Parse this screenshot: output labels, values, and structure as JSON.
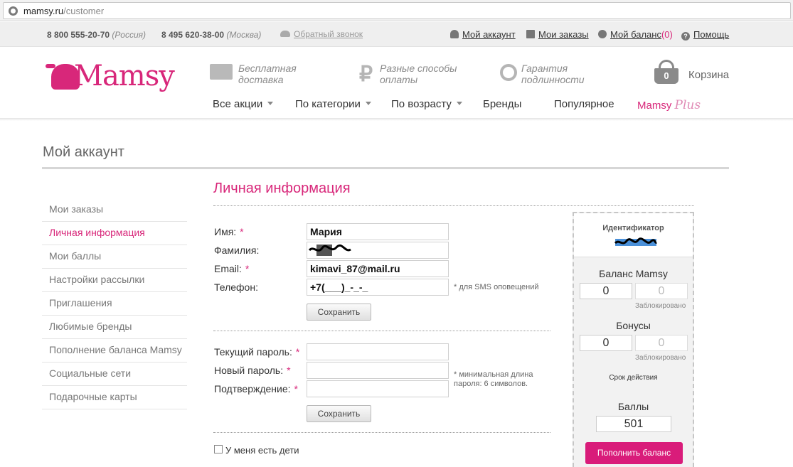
{
  "browser": {
    "url_host": "mamsy.ru",
    "url_path": "/customer"
  },
  "topbar": {
    "phone1": "8 800 555-20-70",
    "phone1_region": "(Россия)",
    "phone2": "8 495 620-38-00",
    "phone2_region": "(Москва)",
    "callback": "Обратный звонок",
    "account": "Мой аккаунт",
    "orders": "Мои заказы",
    "balance": "Мой баланс",
    "balance_count": "(0)",
    "help": "Помощь"
  },
  "header": {
    "logo": "Mamsy",
    "features": [
      {
        "line1": "Бесплатная",
        "line2": "доставка",
        "icon": "truck-icon"
      },
      {
        "line1": "Разные способы",
        "line2": "оплаты",
        "icon": "ruble-icon"
      },
      {
        "line1": "Гарантия",
        "line2": "подлинности",
        "icon": "medal-icon"
      }
    ],
    "cart_count": "0",
    "cart_label": "Корзина",
    "nav": [
      {
        "label": "Все акции",
        "dropdown": true
      },
      {
        "label": "По категории",
        "dropdown": true
      },
      {
        "label": "По возрасту",
        "dropdown": true
      },
      {
        "label": "Бренды",
        "dropdown": false
      },
      {
        "label": "Популярное",
        "dropdown": false
      }
    ],
    "nav_plus_main": "Mamsy",
    "nav_plus_accent": "Plus"
  },
  "page_title": "Мой аккаунт",
  "sidebar": {
    "items": [
      {
        "label": "Мои заказы",
        "active": false
      },
      {
        "label": "Личная информация",
        "active": true
      },
      {
        "label": "Мои баллы",
        "active": false
      },
      {
        "label": "Настройки рассылки",
        "active": false
      },
      {
        "label": "Приглашения",
        "active": false
      },
      {
        "label": "Любимые бренды",
        "active": false
      },
      {
        "label": "Пополнение баланса Mamsy",
        "active": false
      },
      {
        "label": "Социальные сети",
        "active": false
      },
      {
        "label": "Подарочные карты",
        "active": false
      }
    ]
  },
  "personal": {
    "title": "Личная информация",
    "name_label": "Имя:",
    "name_value": "Мария",
    "surname_label": "Фамилия:",
    "email_label": "Email:",
    "email_value": "kimavi_87@mail.ru",
    "phone_label": "Телефон:",
    "phone_value": "+7(___)_-_-_",
    "phone_note": "* для SMS оповещений",
    "save": "Сохранить"
  },
  "password": {
    "current_label": "Текущий пароль:",
    "new_label": "Новый пароль:",
    "confirm_label": "Подтверждение:",
    "note_line1": "* минимальная длина",
    "note_line2": "пароля: 6 символов.",
    "save": "Сохранить"
  },
  "children": {
    "label": "У меня есть дети",
    "checked": false
  },
  "card": {
    "id_label": "Идентификатор",
    "balance_title": "Баланс Mamsy",
    "balance_value": "0",
    "balance_locked": "0",
    "locked_label": "Заблокировано",
    "bonus_title": "Бонусы",
    "bonus_value": "0",
    "bonus_locked": "0",
    "expiry_label": "Срок действия",
    "points_title": "Баллы",
    "points_value": "501",
    "topup": "Пополнить баланс"
  },
  "colors": {
    "brand": "#d8277a",
    "topup_button": "#d91c7a"
  }
}
